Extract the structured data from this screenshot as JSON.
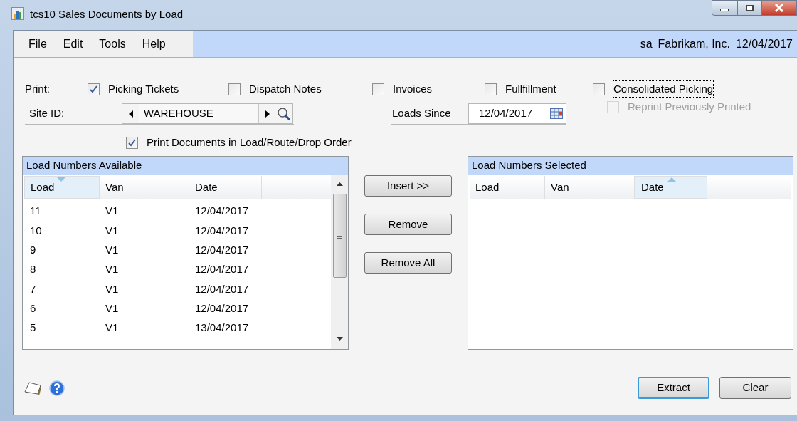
{
  "window": {
    "title": "tcs10 Sales Documents by Load"
  },
  "menu": [
    "File",
    "Edit",
    "Tools",
    "Help"
  ],
  "status": {
    "user": "sa",
    "company": "Fabrikam, Inc.",
    "date": "12/04/2017"
  },
  "print_options": {
    "label": "Print:",
    "items": [
      {
        "label": "Picking Tickets",
        "checked": true,
        "focused": false
      },
      {
        "label": "Dispatch Notes",
        "checked": false,
        "focused": false
      },
      {
        "label": "Invoices",
        "checked": false,
        "focused": false
      },
      {
        "label": "Fullfillment",
        "checked": false,
        "focused": false
      },
      {
        "label": "Consolidated Picking",
        "checked": false,
        "focused": true
      }
    ]
  },
  "reprint": {
    "label": "Reprint Previously Printed",
    "checked": false,
    "disabled": true
  },
  "site_id": {
    "label": "Site ID:",
    "value": "WAREHOUSE"
  },
  "loads_since": {
    "label": "Loads Since",
    "value": "12/04/2017"
  },
  "load_order": {
    "label": "Print Documents in Load/Route/Drop Order",
    "checked": true
  },
  "available": {
    "title": "Load Numbers Available",
    "columns": [
      {
        "label": "Load",
        "sorted": true,
        "ascending": false
      },
      {
        "label": "Van",
        "sorted": false
      },
      {
        "label": "Date",
        "sorted": false
      }
    ],
    "rows": [
      [
        "11",
        "V1",
        "12/04/2017"
      ],
      [
        "10",
        "V1",
        "12/04/2017"
      ],
      [
        "9",
        "V1",
        "12/04/2017"
      ],
      [
        "8",
        "V1",
        "12/04/2017"
      ],
      [
        "7",
        "V1",
        "12/04/2017"
      ],
      [
        "6",
        "V1",
        "12/04/2017"
      ],
      [
        "5",
        "V1",
        "13/04/2017"
      ]
    ]
  },
  "transfer_buttons": [
    "Insert >>",
    "Remove",
    "Remove All"
  ],
  "selected": {
    "title": "Load Numbers Selected",
    "columns": [
      {
        "label": "Load",
        "sorted": false
      },
      {
        "label": "Van",
        "sorted": false
      },
      {
        "label": "Date",
        "sorted": true,
        "ascending": true
      }
    ]
  },
  "footer_buttons": [
    {
      "label": "Extract",
      "default": true
    },
    {
      "label": "Clear",
      "default": false
    }
  ]
}
